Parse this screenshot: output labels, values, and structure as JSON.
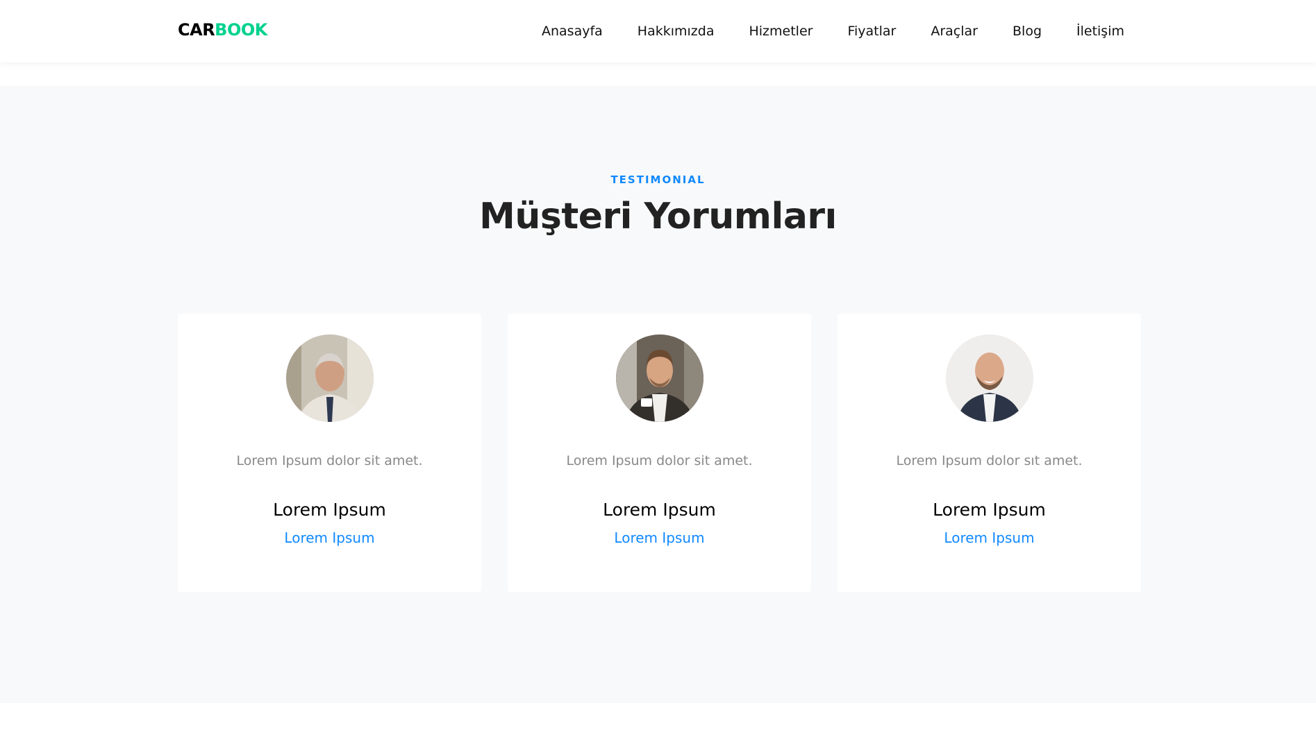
{
  "header": {
    "logo_part1": "CAR",
    "logo_part2": "BOOK",
    "nav": [
      {
        "label": "Anasayfa"
      },
      {
        "label": "Hakkımızda"
      },
      {
        "label": "Hizmetler"
      },
      {
        "label": "Fiyatlar"
      },
      {
        "label": "Araçlar"
      },
      {
        "label": "Blog"
      },
      {
        "label": "İletişim"
      }
    ]
  },
  "testimonials": {
    "subheading": "TESTIMONIAL",
    "heading": "Müşteri Yorumları",
    "items": [
      {
        "quote": "Lorem Ipsum dolor sit amet.",
        "name": "Lorem Ipsum",
        "position": "Lorem Ipsum"
      },
      {
        "quote": "Lorem Ipsum dolor sit amet.",
        "name": "Lorem Ipsum",
        "position": "Lorem Ipsum"
      },
      {
        "quote": "Lorem Ipsum dolor sıt amet.",
        "name": "Lorem Ipsum",
        "position": "Lorem Ipsum"
      }
    ]
  },
  "colors": {
    "accent_green": "#01d28e",
    "accent_blue": "#1089ff",
    "section_bg": "#f8f9fa"
  }
}
